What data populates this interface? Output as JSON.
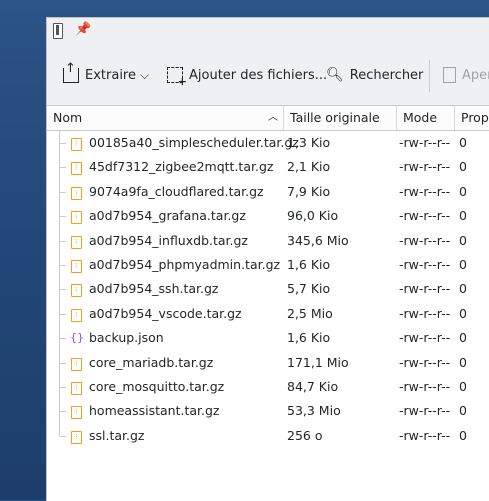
{
  "toolbar": {
    "extract_label": "Extraire",
    "add_label": "Ajouter des fichiers...",
    "search_label": "Rechercher",
    "preview_label": "Aper"
  },
  "columns": {
    "name": "Nom",
    "size": "Taille originale",
    "mode": "Mode",
    "owner": "Prop"
  },
  "files": [
    {
      "name": "00185a40_simplescheduler.tar.gz",
      "size": "1,3 Kio",
      "mode": "-rw-r--r--",
      "owner": "0",
      "icon": "archive-icon"
    },
    {
      "name": "45df7312_zigbee2mqtt.tar.gz",
      "size": "2,1 Kio",
      "mode": "-rw-r--r--",
      "owner": "0",
      "icon": "archive-icon"
    },
    {
      "name": "9074a9fa_cloudflared.tar.gz",
      "size": "7,9 Kio",
      "mode": "-rw-r--r--",
      "owner": "0",
      "icon": "archive-icon"
    },
    {
      "name": "a0d7b954_grafana.tar.gz",
      "size": "96,0 Kio",
      "mode": "-rw-r--r--",
      "owner": "0",
      "icon": "archive-icon"
    },
    {
      "name": "a0d7b954_influxdb.tar.gz",
      "size": "345,6 Mio",
      "mode": "-rw-r--r--",
      "owner": "0",
      "icon": "archive-icon"
    },
    {
      "name": "a0d7b954_phpmyadmin.tar.gz",
      "size": "1,6 Kio",
      "mode": "-rw-r--r--",
      "owner": "0",
      "icon": "archive-icon"
    },
    {
      "name": "a0d7b954_ssh.tar.gz",
      "size": "5,7 Kio",
      "mode": "-rw-r--r--",
      "owner": "0",
      "icon": "archive-icon"
    },
    {
      "name": "a0d7b954_vscode.tar.gz",
      "size": "2,5 Mio",
      "mode": "-rw-r--r--",
      "owner": "0",
      "icon": "archive-icon"
    },
    {
      "name": "backup.json",
      "size": "1,6 Kio",
      "mode": "-rw-r--r--",
      "owner": "0",
      "icon": "json-icon"
    },
    {
      "name": "core_mariadb.tar.gz",
      "size": "171,1 Mio",
      "mode": "-rw-r--r--",
      "owner": "0",
      "icon": "archive-icon"
    },
    {
      "name": "core_mosquitto.tar.gz",
      "size": "84,7 Kio",
      "mode": "-rw-r--r--",
      "owner": "0",
      "icon": "archive-icon"
    },
    {
      "name": "homeassistant.tar.gz",
      "size": "53,3 Mio",
      "mode": "-rw-r--r--",
      "owner": "0",
      "icon": "archive-icon"
    },
    {
      "name": "ssl.tar.gz",
      "size": "256 o",
      "mode": "-rw-r--r--",
      "owner": "0",
      "icon": "archive-icon"
    }
  ]
}
